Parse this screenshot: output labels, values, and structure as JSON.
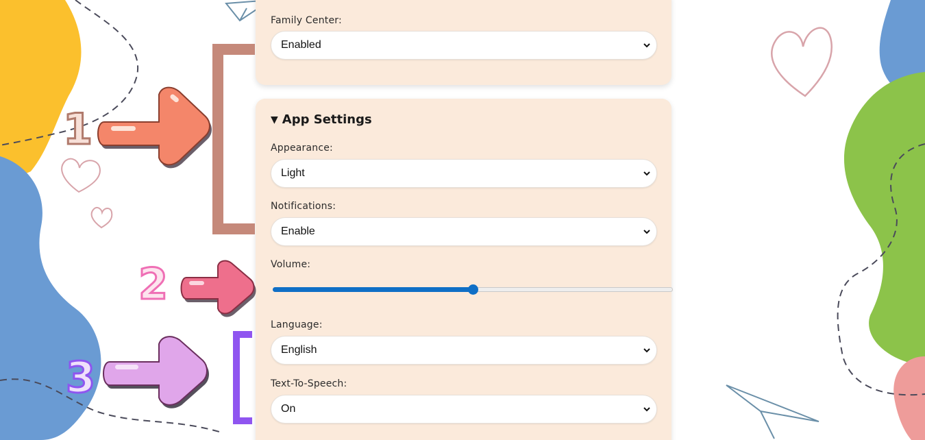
{
  "top_card": {
    "family_center": {
      "label": "Family Center:",
      "value": "Enabled"
    }
  },
  "app_settings": {
    "title": "App Settings",
    "appearance": {
      "label": "Appearance:",
      "value": "Light"
    },
    "notifications": {
      "label": "Notifications:",
      "value": "Enable"
    },
    "volume": {
      "label": "Volume:",
      "level_percent": 50
    },
    "language": {
      "label": "Language:",
      "value": "English"
    },
    "text_to_speech": {
      "label": "Text-To-Speech:",
      "value": "On"
    }
  },
  "annotations": {
    "marker_1": "1",
    "marker_2": "2",
    "marker_3": "3"
  },
  "colors": {
    "card_bg": "#fbeadb",
    "slider_accent": "#0f6fc6",
    "arrow_1": "#f4866a",
    "arrow_2": "#ee6f8c",
    "arrow_3": "#e0a6ea",
    "bracket_1": "#c5897a",
    "bracket_3": "#8f55f0"
  }
}
